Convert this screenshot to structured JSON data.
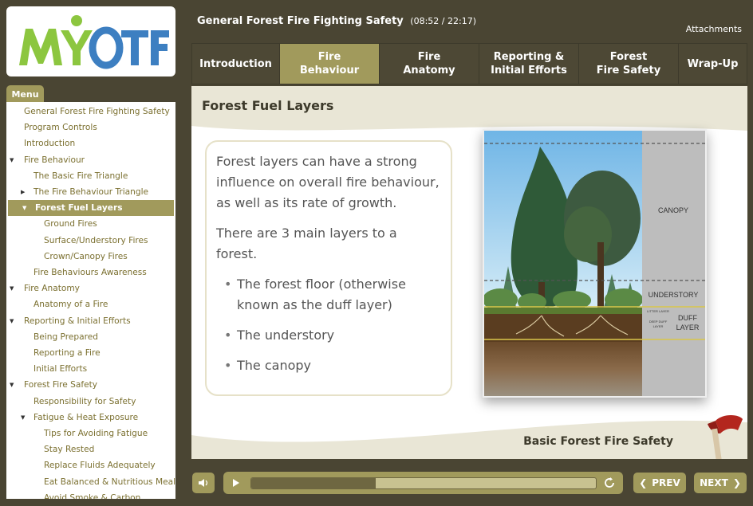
{
  "logo": {
    "text": "MYOTF"
  },
  "header": {
    "course_title": "General Forest Fire Fighting Safety",
    "time": "(08:52 / 22:17)",
    "attachments": "Attachments"
  },
  "menu": {
    "tab_label": "Menu",
    "items": [
      {
        "label": "General Forest Fire Fighting Safety",
        "level": 0,
        "arrow": ""
      },
      {
        "label": "Program Controls",
        "level": 0,
        "arrow": ""
      },
      {
        "label": "Introduction",
        "level": 0,
        "arrow": ""
      },
      {
        "label": "Fire Behaviour",
        "level": 0,
        "arrow": "▼"
      },
      {
        "label": "The Basic Fire Triangle",
        "level": 1,
        "arrow": ""
      },
      {
        "label": "The Fire Behaviour Triangle",
        "level": 1,
        "arrow": "▶"
      },
      {
        "label": "Forest Fuel Layers",
        "level": 1,
        "arrow": "▼"
      },
      {
        "label": "Ground Fires",
        "level": 2,
        "arrow": ""
      },
      {
        "label": "Surface/Understory Fires",
        "level": 2,
        "arrow": ""
      },
      {
        "label": "Crown/Canopy Fires",
        "level": 2,
        "arrow": ""
      },
      {
        "label": "Fire Behaviours Awareness",
        "level": 1,
        "arrow": ""
      },
      {
        "label": "Fire Anatomy",
        "level": 0,
        "arrow": "▼"
      },
      {
        "label": "Anatomy of a Fire",
        "level": 1,
        "arrow": ""
      },
      {
        "label": "Reporting & Initial Efforts",
        "level": 0,
        "arrow": "▼"
      },
      {
        "label": "Being Prepared",
        "level": 1,
        "arrow": ""
      },
      {
        "label": "Reporting a Fire",
        "level": 1,
        "arrow": ""
      },
      {
        "label": "Initial Efforts",
        "level": 1,
        "arrow": ""
      },
      {
        "label": "Forest Fire Safety",
        "level": 0,
        "arrow": "▼"
      },
      {
        "label": "Responsibility for Safety",
        "level": 1,
        "arrow": ""
      },
      {
        "label": "Fatigue & Heat Exposure",
        "level": 1,
        "arrow": "▼"
      },
      {
        "label": "Tips for Avoiding Fatigue",
        "level": 2,
        "arrow": ""
      },
      {
        "label": "Stay Rested",
        "level": 2,
        "arrow": ""
      },
      {
        "label": "Replace Fluids Adequately",
        "level": 2,
        "arrow": ""
      },
      {
        "label": "Eat Balanced & Nutritious Meals",
        "level": 2,
        "arrow": ""
      },
      {
        "label": "Avoid Smoke & Carbon...",
        "level": 2,
        "arrow": ""
      }
    ],
    "active_index": 6
  },
  "nav": {
    "tabs": [
      {
        "label": "Introduction"
      },
      {
        "label": "Fire\nBehaviour"
      },
      {
        "label": "Fire\nAnatomy"
      },
      {
        "label": "Reporting &\nInitial Efforts"
      },
      {
        "label": "Forest\nFire Safety"
      },
      {
        "label": "Wrap-Up"
      }
    ],
    "active_index": 1
  },
  "slide": {
    "title": "Forest Fuel Layers",
    "para1": "Forest layers can have a strong influence on overall fire behaviour, as well as its rate of growth.",
    "para2": "There are 3 main layers to a forest.",
    "bullets": [
      "The forest floor (otherwise known as the duff layer)",
      "The understory",
      "The canopy"
    ],
    "footer": "Basic Forest Fire Safety"
  },
  "diagram": {
    "canopy": "CANOPY",
    "understory": "UNDERSTORY",
    "litter": "LITTER LAYER",
    "deep_duff": "DEEP DUFF",
    "deep_duff2": "LAYER",
    "duff": "DUFF",
    "duff2": "LAYER"
  },
  "controls": {
    "prev": "PREV",
    "next": "NEXT",
    "progress": 0.36
  },
  "colors": {
    "olive": "#a19a5c",
    "dark": "#4a4533",
    "logo_green": "#8cc63f",
    "logo_blue": "#3d7fc1"
  }
}
